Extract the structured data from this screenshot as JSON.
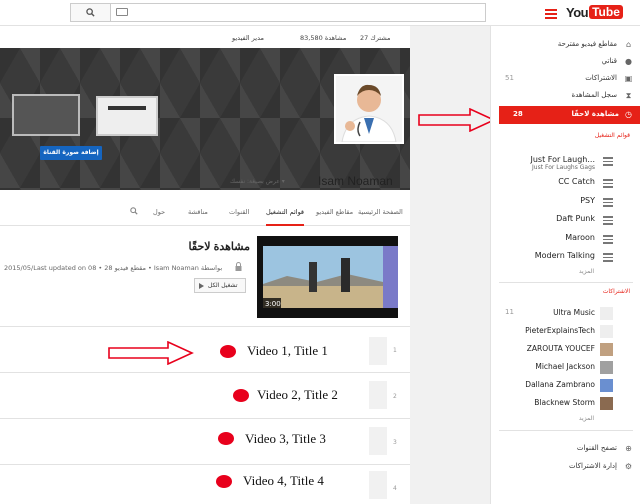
{
  "header": {
    "logo_you": "You",
    "logo_tube": "Tube"
  },
  "sidebar": {
    "nav": [
      {
        "label": "مقاطع فيديو مقترحة",
        "icon": "home-icon",
        "count": ""
      },
      {
        "label": "قناتي",
        "icon": "person-icon",
        "count": ""
      },
      {
        "label": "الاشتراكات",
        "icon": "subscriptions-icon",
        "count": "51"
      },
      {
        "label": "سجل المشاهدة",
        "icon": "hourglass-icon",
        "count": ""
      },
      {
        "label": "مشاهدة لاحقًا",
        "icon": "clock-icon",
        "count": "28"
      }
    ],
    "playlists_heading": "قوائم التشغيل",
    "playlists": [
      {
        "label": "Just For Laugh...",
        "sub": "Just For Laughs Gags"
      },
      {
        "label": "CC Catch",
        "sub": ""
      },
      {
        "label": "PSY",
        "sub": ""
      },
      {
        "label": "Daft Punk",
        "sub": ""
      },
      {
        "label": "Maroon",
        "sub": ""
      },
      {
        "label": "Modern Talking",
        "sub": ""
      }
    ],
    "more_label": "المزيد",
    "subs_heading": "الاشتراكات",
    "subscriptions": [
      {
        "label": "Ultra Music",
        "count": "11",
        "avatar_color": "#eeeeee"
      },
      {
        "label": "PieterExplainsTech",
        "count": "",
        "avatar_color": "#eeeeee"
      },
      {
        "label": "ZAROUTA YOUCEF",
        "count": "",
        "avatar_color": "#c0a080"
      },
      {
        "label": "Michael Jackson",
        "count": "",
        "avatar_color": "#a0a0a0"
      },
      {
        "label": "Dallana Zambrano",
        "count": "",
        "avatar_color": "#6a8fd0"
      },
      {
        "label": "Blacknew Storm",
        "count": "",
        "avatar_color": "#8a6a50"
      }
    ],
    "more_label_2": "المزيد",
    "bottom": [
      {
        "label": "تصفح القنوات",
        "icon": "plus-circle-icon"
      },
      {
        "label": "إدارة الاشتراكات",
        "icon": "gear-icon"
      }
    ]
  },
  "channel": {
    "stats_subscribers": "27 مشترك",
    "stats_views": "83,580 مشاهدة",
    "stats_manager": "مدير الفيديو",
    "add_art_label": "إضافة صورة القناة",
    "name": "Isam Noaman",
    "view_as": "عرض بصيغة: نفسك ▾",
    "tabs": [
      "الصفحة الرئيسية",
      "مقاطع الفيديو",
      "قوائم التشغيل",
      "القنوات",
      "مناقشة",
      "حول"
    ],
    "selected_tab": 2
  },
  "playlist": {
    "title": "مشاهدة لاحقًا",
    "meta": "2015/05/Last updated on 08 • مقطع فيديو 28 • Isam Noaman بواسطة",
    "play_all": "تشغيل الكل",
    "thumb_duration": "3:00"
  },
  "videos": [
    {
      "index": "1",
      "title": "Video 1, Title 1"
    },
    {
      "index": "2",
      "title": "Video 2, Title 2"
    },
    {
      "index": "3",
      "title": "Video 3, Title 3"
    },
    {
      "index": "4",
      "title": "Video 4, Title 4"
    }
  ],
  "colors": {
    "accent": "#e62117",
    "dot": "#e8001c",
    "button_blue": "#1565c0"
  }
}
